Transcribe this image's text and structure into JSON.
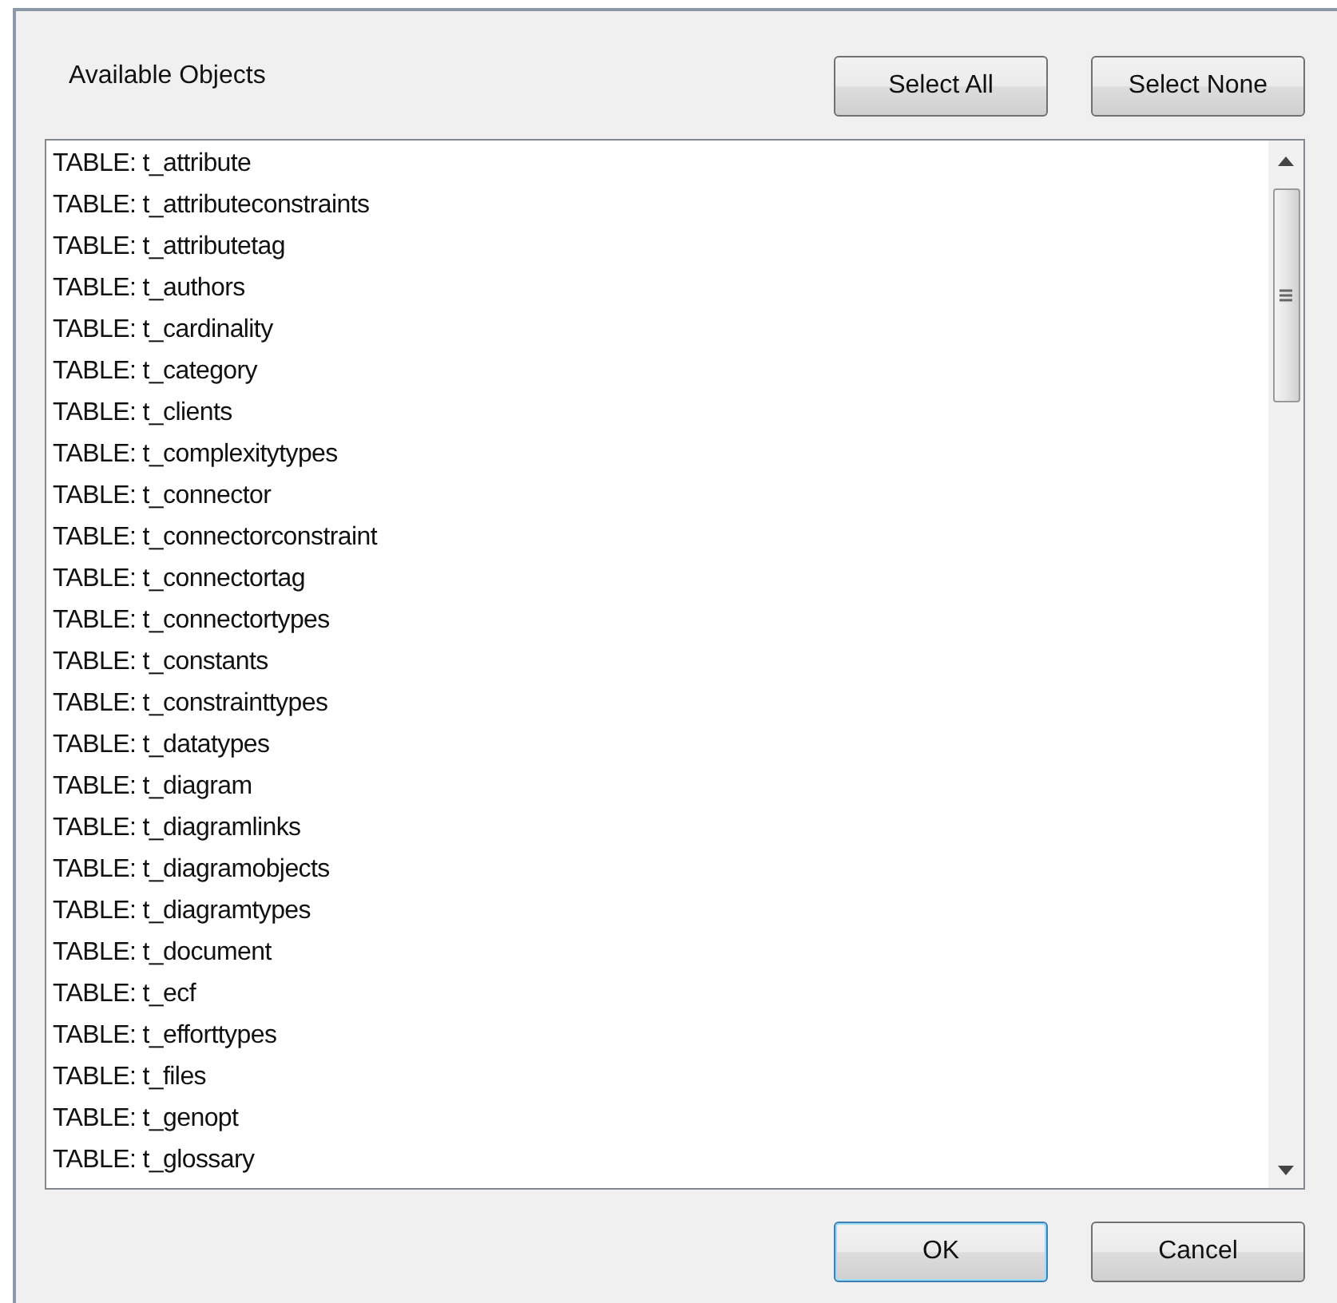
{
  "header": {
    "label": "Available Objects",
    "buttons": [
      {
        "label": "Select All",
        "default": false
      },
      {
        "label": "Select None",
        "default": false
      }
    ]
  },
  "objects": [
    "TABLE: t_attribute",
    "TABLE: t_attributeconstraints",
    "TABLE: t_attributetag",
    "TABLE: t_authors",
    "TABLE: t_cardinality",
    "TABLE: t_category",
    "TABLE: t_clients",
    "TABLE: t_complexitytypes",
    "TABLE: t_connector",
    "TABLE: t_connectorconstraint",
    "TABLE: t_connectortag",
    "TABLE: t_connectortypes",
    "TABLE: t_constants",
    "TABLE: t_constrainttypes",
    "TABLE: t_datatypes",
    "TABLE: t_diagram",
    "TABLE: t_diagramlinks",
    "TABLE: t_diagramobjects",
    "TABLE: t_diagramtypes",
    "TABLE: t_document",
    "TABLE: t_ecf",
    "TABLE: t_efforttypes",
    "TABLE: t_files",
    "TABLE: t_genopt",
    "TABLE: t_glossary"
  ],
  "footer": {
    "buttons": [
      {
        "label": "OK",
        "default": true
      },
      {
        "label": "Cancel",
        "default": false
      }
    ]
  }
}
